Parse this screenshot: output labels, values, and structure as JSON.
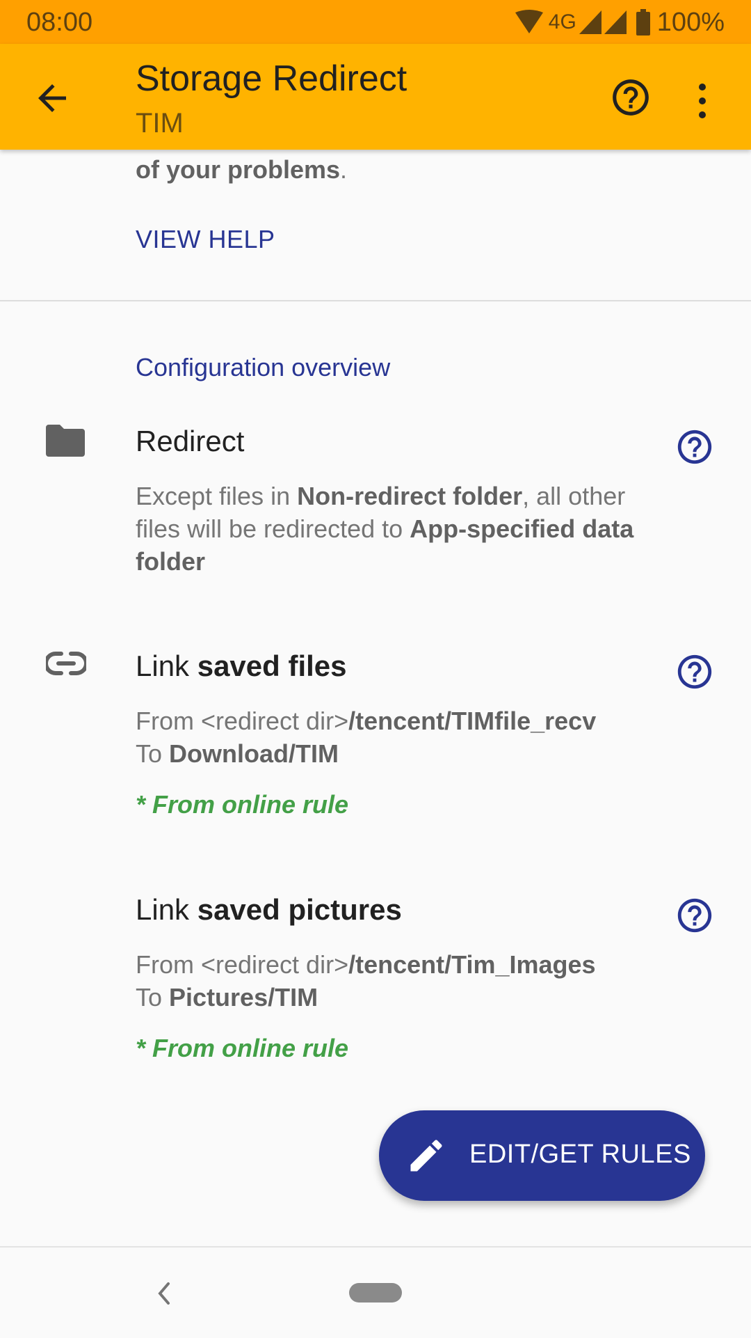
{
  "status_bar": {
    "time": "08:00",
    "network": "4G",
    "battery": "100%"
  },
  "app_bar": {
    "title": "Storage Redirect",
    "subtitle": "TIM"
  },
  "intro": {
    "tail_bold": "of your problems",
    "tail_end": ".",
    "view_help": "VIEW HELP"
  },
  "section_title": "Configuration overview",
  "redirect": {
    "title": "Redirect",
    "desc_1": "Except files in ",
    "desc_bold_1": "Non-redirect folder",
    "desc_2": ", all other files will be redirected to ",
    "desc_bold_2": "App-specified data folder"
  },
  "link_files": {
    "title_prefix": "Link ",
    "title_bold": "saved files",
    "from_label": "From <redirect dir>",
    "from_path": "/tencent/TIMfile_recv",
    "to_label": "To ",
    "to_path": "Download/TIM",
    "rule": "* From online rule"
  },
  "link_pictures": {
    "title_prefix": "Link ",
    "title_bold": "saved pictures",
    "from_label": "From <redirect dir>",
    "from_path": "/tencent/Tim_Images",
    "to_label": "To ",
    "to_path": "Pictures/TIM",
    "rule": "* From online rule"
  },
  "fab": {
    "label": "EDIT/GET RULES"
  },
  "colors": {
    "status_bar": "#ffa000",
    "app_bar": "#ffb300",
    "accent": "#283593",
    "online_rule": "#43a047"
  },
  "icons": {
    "back": "arrow-left-icon",
    "help": "help-circle-icon",
    "more": "more-vert-icon",
    "folder": "folder-icon",
    "link": "link-icon",
    "edit": "pencil-icon"
  }
}
